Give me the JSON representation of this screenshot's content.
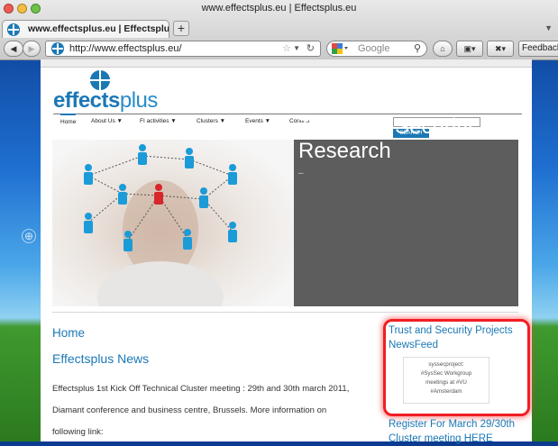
{
  "window": {
    "title": "www.effectsplus.eu | Effectsplus.eu"
  },
  "tabs": [
    {
      "label": "www.effectsplus.eu | Effectsplu..."
    }
  ],
  "toolbar": {
    "url": "http://www.effectsplus.eu/",
    "search_placeholder": "Google",
    "feedback_label": "Feedback"
  },
  "site": {
    "logo_main": "effects",
    "logo_plus": "plus",
    "menu": [
      {
        "label": "Home",
        "active": true
      },
      {
        "label": "About Us ▼"
      },
      {
        "label": "FI activities ▼"
      },
      {
        "label": "Clusters ▼"
      },
      {
        "label": "Events ▼"
      },
      {
        "label": "Contact"
      }
    ],
    "search_button": "SEARCH",
    "hero": {
      "title": "Create Roadmap for Trust and Security Research",
      "dash": "–"
    },
    "main": {
      "heading": "Home",
      "news_heading": "Effectsplus News",
      "body": "Effectsplus 1st Kick Off Technical Cluster meeting  : 29th and 30th march 2011, Diamant conference and business centre, Brussels. More information on following link:"
    },
    "sidebar": {
      "newsfeed_title": "Trust and Security Projects NewsFeed",
      "tweet": [
        "syssecproject:",
        "#SysSec Workgroup",
        "meetings at #VU",
        "#Amsterdam"
      ],
      "register_link": "Register For March 29/30th Cluster meeting HERE"
    }
  },
  "colors": {
    "brand": "#1b78b5",
    "highlight": "#f01e24",
    "hero_panel": "#5d5d5d"
  }
}
